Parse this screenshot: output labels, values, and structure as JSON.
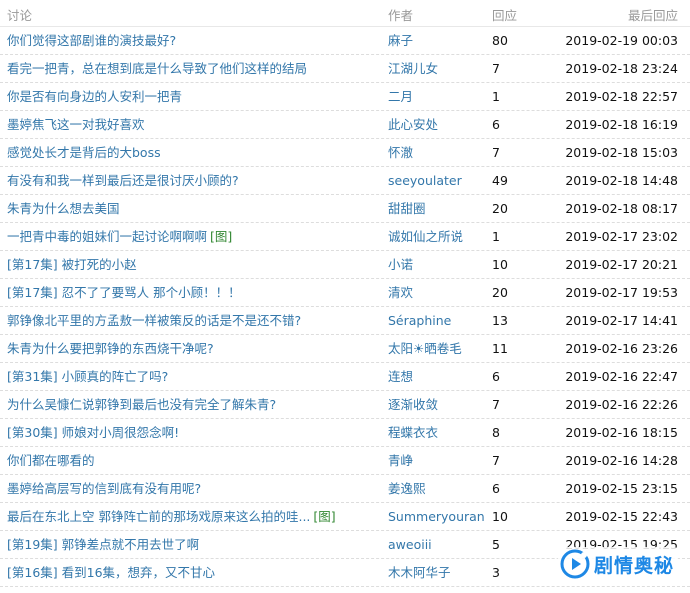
{
  "header": {
    "topic": "讨论",
    "author": "作者",
    "replies": "回应",
    "last_reply": "最后回应"
  },
  "rows": [
    {
      "topic": "你们觉得这部剧谁的演技最好?",
      "tag": "",
      "author": "麻子",
      "replies": "80",
      "last_reply": "2019-02-19 00:03"
    },
    {
      "topic": "看完一把青，总在想到底是什么导致了他们这样的结局",
      "tag": "",
      "author": "江湖儿女",
      "replies": "7",
      "last_reply": "2019-02-18 23:24"
    },
    {
      "topic": "你是否有向身边的人安利一把青",
      "tag": "",
      "author": "二月",
      "replies": "1",
      "last_reply": "2019-02-18 22:57"
    },
    {
      "topic": "墨婷焦飞这一对我好喜欢",
      "tag": "",
      "author": "此心安处",
      "replies": "6",
      "last_reply": "2019-02-18 16:19"
    },
    {
      "topic": "感觉处长才是背后的大boss",
      "tag": "",
      "author": "怀澈",
      "replies": "7",
      "last_reply": "2019-02-18 15:03"
    },
    {
      "topic": "有没有和我一样到最后还是很讨厌小顾的?",
      "tag": "",
      "author": "seeyoulater",
      "replies": "49",
      "last_reply": "2019-02-18 14:48"
    },
    {
      "topic": "朱青为什么想去美国",
      "tag": "",
      "author": "甜甜圈",
      "replies": "20",
      "last_reply": "2019-02-18 08:17"
    },
    {
      "topic": "一把青中毒的姐妹们一起讨论啊啊啊",
      "tag": "[图]",
      "author": "诚如仙之所说",
      "replies": "1",
      "last_reply": "2019-02-17 23:02"
    },
    {
      "topic": "[第17集] 被打死的小赵",
      "tag": "",
      "author": "小诺",
      "replies": "10",
      "last_reply": "2019-02-17 20:21"
    },
    {
      "topic": "[第17集] 忍不了了要骂人 那个小顾！！！",
      "tag": "",
      "author": "清欢",
      "replies": "20",
      "last_reply": "2019-02-17 19:53"
    },
    {
      "topic": "郭铮像北平里的方孟敖一样被策反的话是不是还不错?",
      "tag": "",
      "author": "Séraphine",
      "replies": "13",
      "last_reply": "2019-02-17 14:41"
    },
    {
      "topic": "朱青为什么要把郭铮的东西烧干净呢?",
      "tag": "",
      "author": "太阳☀晒卷毛",
      "replies": "11",
      "last_reply": "2019-02-16 23:26"
    },
    {
      "topic": "[第31集] 小顾真的阵亡了吗?",
      "tag": "",
      "author": "连想",
      "replies": "6",
      "last_reply": "2019-02-16 22:47"
    },
    {
      "topic": "为什么吴慷仁说郭铮到最后也没有完全了解朱青?",
      "tag": "",
      "author": "逐渐收敛",
      "replies": "7",
      "last_reply": "2019-02-16 22:26"
    },
    {
      "topic": "[第30集] 师娘对小周很怨念啊!",
      "tag": "",
      "author": "程蝶衣衣",
      "replies": "8",
      "last_reply": "2019-02-16 18:15"
    },
    {
      "topic": "你们都在哪看的",
      "tag": "",
      "author": "青峥",
      "replies": "7",
      "last_reply": "2019-02-16 14:28"
    },
    {
      "topic": "墨婷给高层写的信到底有没有用呢?",
      "tag": "",
      "author": "姜逸熙",
      "replies": "6",
      "last_reply": "2019-02-15 23:15"
    },
    {
      "topic": "最后在东北上空 郭铮阵亡前的那场戏原来这么拍的哇...",
      "tag": "[图]",
      "author": "Summeryouran",
      "replies": "10",
      "last_reply": "2019-02-15 22:43"
    },
    {
      "topic": "[第19集] 郭铮差点就不用去世了啊",
      "tag": "",
      "author": "aweoiii",
      "replies": "5",
      "last_reply": "2019-02-15 19:25"
    },
    {
      "topic": "[第16集] 看到16集，想弃，又不甘心",
      "tag": "",
      "author": "木木阿华子",
      "replies": "3",
      "last_reply": ""
    }
  ],
  "watermark": {
    "text": "剧情奥秘",
    "icon": "play-logo-icon",
    "color": "#1e88e5"
  },
  "colors": {
    "link": "#3377aa",
    "tag": "#338833",
    "header_text": "#999999",
    "body_text": "#111111"
  }
}
